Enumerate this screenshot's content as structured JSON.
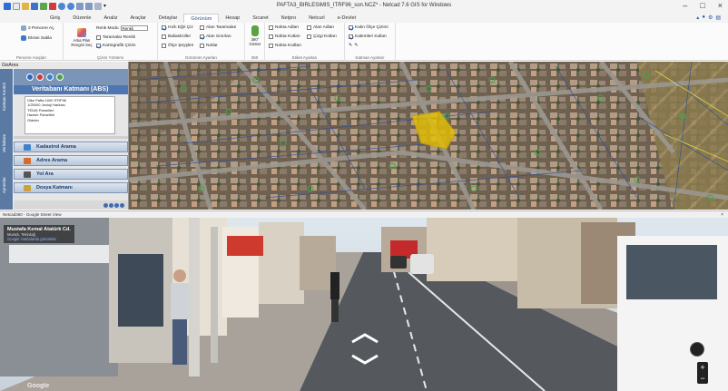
{
  "window": {
    "title": "PAFTA3_BIRLESIMIS_ITRF96_son.NCZ* - Netcad 7.6 GIS for Windows",
    "controls": [
      "–",
      "□",
      "×"
    ]
  },
  "ribbon_tabs": [
    "Giriş",
    "Düzenle",
    "Analiz",
    "Araçlar",
    "Detaylar",
    "Görünüm",
    "Hesap",
    "Sıcaret",
    "Netpro",
    "Netcurl",
    "e-Devlet"
  ],
  "active_tab": "Görünüm",
  "ribbon": {
    "pencere": {
      "items": [
        "2 Pencere Aç",
        "Ekran Sakla"
      ],
      "label": "Pencere Araçları"
    },
    "cizim": {
      "big_button": "Arka Plan Rengini Seç",
      "renk_modu_label": "Renk Modu",
      "renk_modu_value": "Renkli",
      "items": [
        "Taramalar Renkli",
        "Kartografik Çizim"
      ],
      "label": "Çizim Yöntemi"
    },
    "gorunum": {
      "items": [
        "Hızlı Eğri Çiz",
        "Alan Taramaları",
        "Baliastroller",
        "Alan Sınırları",
        "Ölçe Şeyşlen",
        "Notlar"
      ],
      "label": "Görünüm Ayarları"
    },
    "g360": {
      "big_button": "360° Göster",
      "label": "360"
    },
    "etiket": {
      "items": [
        "Nokta Adları",
        "Alan Adları",
        "Nokta Kotları",
        "Çizgi Kotları",
        "Nokta Kodları"
      ],
      "label": "Etiket Ayarları"
    },
    "katman": {
      "items": [
        "Kalın Ölçe Çizimi",
        "Kalemleri Kullan"
      ],
      "label": "Katman Ayarları"
    }
  },
  "left_panel": {
    "header": "GisArea",
    "vertical_tabs": [
      "Katman Kontrol",
      "Veritabanı",
      "Ayrıntılar"
    ],
    "title": "Veritabanı Katmanı (ABS)",
    "list": [
      "Ülke Pafta 1000 ITRF96",
      "1/25000 Jeoloji Haritası",
      "TEİAŞ Parselleri",
      "Hazine Parselleri",
      "Gideler"
    ],
    "buttons": [
      "Kadastrol Arama",
      "Adres Arama",
      "Yol Ara",
      "Dosya Katmanı"
    ]
  },
  "streetview": {
    "bar_title": "Netcad360 - Google Street View",
    "close": "×",
    "place_name": "Mustafa Kemal Atatürk Cd.",
    "place_sub": "Muratlı, Tekirdağ",
    "place_link": "Google Haritalarda görüntüle",
    "watermark": "Google"
  },
  "colors": {
    "file_tab": "#f0a000",
    "accent": "#1f4e96",
    "panel_blue": "#4f76b0",
    "selection_yellow": "#e5c100"
  }
}
